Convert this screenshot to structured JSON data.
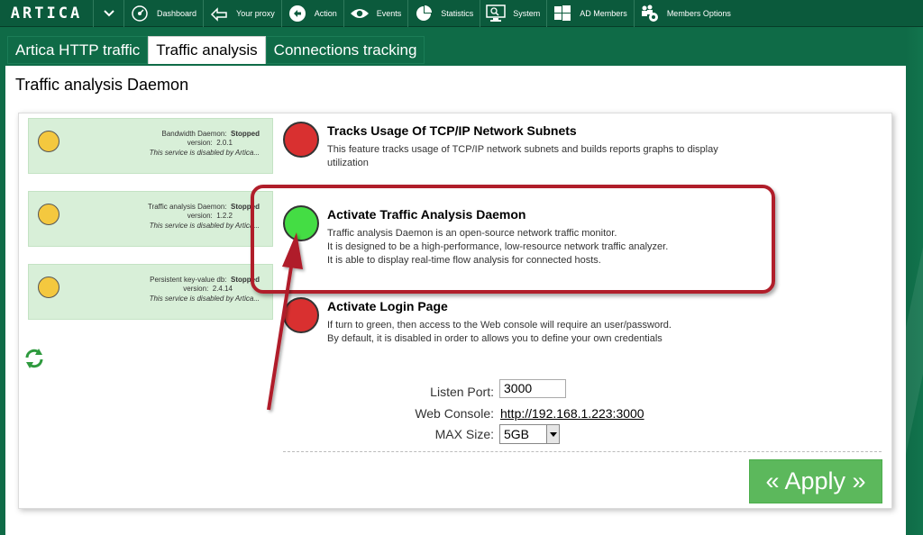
{
  "app": {
    "logo": "ARTICA"
  },
  "nav": {
    "items": [
      {
        "label": "Dashboard",
        "icon": "dashboard-icon"
      },
      {
        "label": "Your proxy",
        "icon": "proxy-icon"
      },
      {
        "label": "Action",
        "icon": "action-icon"
      },
      {
        "label": "Events",
        "icon": "eye-icon"
      },
      {
        "label": "Statistics",
        "icon": "pie-chart-icon"
      },
      {
        "label": "System",
        "icon": "monitor-icon"
      },
      {
        "label": "AD Members",
        "icon": "windows-icon"
      },
      {
        "label": "Members Options",
        "icon": "members-gear-icon"
      }
    ]
  },
  "tabs": [
    {
      "label": "Artica HTTP traffic",
      "active": false
    },
    {
      "label": "Traffic analysis",
      "active": true
    },
    {
      "label": "Connections tracking",
      "active": false
    }
  ],
  "page": {
    "title": "Traffic analysis Daemon"
  },
  "services": [
    {
      "name": "Bandwidth Daemon:",
      "status": "Stopped",
      "version_label": "version:",
      "version": "2.0.1",
      "note": "This service is disabled by Artica...",
      "status_color": "#f4c83f"
    },
    {
      "name": "Traffic analysis Daemon:",
      "status": "Stopped",
      "version_label": "version:",
      "version": "1.2.2",
      "note": "This service is disabled by Artica...",
      "status_color": "#f4c83f"
    },
    {
      "name": "Persistent key-value db:",
      "status": "Stopped",
      "version_label": "version:",
      "version": "2.4.14",
      "note": "This service is disabled by Artica...",
      "status_color": "#f4c83f"
    }
  ],
  "features": [
    {
      "title": "Tracks Usage Of TCP/IP Network Subnets",
      "desc": [
        "This feature tracks usage of TCP/IP network subnets and builds reports graphs to display",
        "utilization"
      ],
      "state_color": "#d93030"
    },
    {
      "title": "Activate Traffic Analysis Daemon",
      "desc": [
        "Traffic analysis Daemon is an open-source network traffic monitor.",
        "It is designed to be a high-performance, low-resource network traffic analyzer.",
        "It is able to display real-time flow analysis for connected hosts."
      ],
      "state_color": "#44dd44"
    },
    {
      "title": "Activate Login Page",
      "desc": [
        "If turn to green, then access to the Web console will require an user/password.",
        "By default, it is disabled in order to allows you to define your own credentials"
      ],
      "state_color": "#d93030"
    }
  ],
  "form": {
    "listen_port_label": "Listen Port:",
    "listen_port_value": "3000",
    "web_console_label": "Web Console:",
    "web_console_link": "http://192.168.1.223:3000",
    "max_size_label": "MAX Size:",
    "max_size_value": "5GB"
  },
  "apply_label": "« Apply »",
  "colors": {
    "brand_green": "#0f6b47",
    "apply_green": "#5cb85c",
    "callout_red": "#b01e2a",
    "service_bg": "#d8efd8"
  }
}
